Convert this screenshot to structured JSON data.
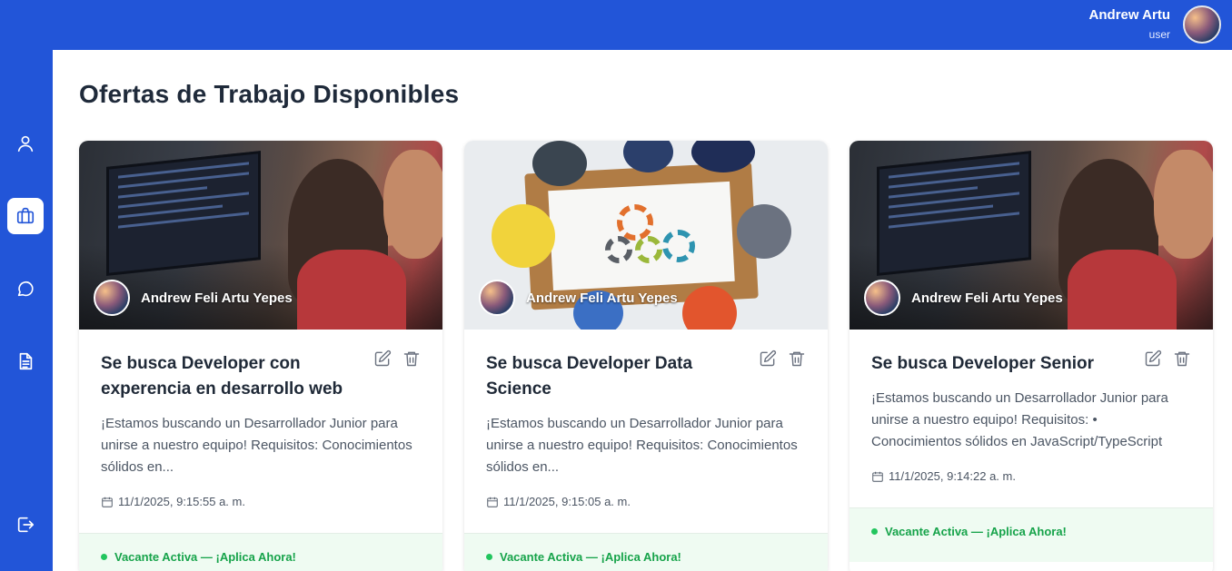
{
  "header": {
    "user_name": "Andrew Artu",
    "user_role": "user",
    "avatar_icon": "user-avatar"
  },
  "sidebar": {
    "items": [
      {
        "icon": "user-icon",
        "active": false
      },
      {
        "icon": "briefcase-icon",
        "active": true
      },
      {
        "icon": "chat-icon",
        "active": false
      },
      {
        "icon": "document-icon",
        "active": false
      }
    ],
    "logout_icon": "logout-icon"
  },
  "page": {
    "title": "Ofertas de Trabajo Disponibles"
  },
  "jobs": [
    {
      "author": "Andrew Feli Artu Yepes",
      "title": "Se busca Developer con experencia en desarrollo web",
      "description": "¡Estamos buscando un Desarrollador Junior para unirse a nuestro equipo! Requisitos: Conocimientos sólidos en...",
      "date": "11/1/2025, 9:15:55 a. m.",
      "status": "Vacante Activa — ¡Aplica Ahora!"
    },
    {
      "author": "Andrew Feli Artu Yepes",
      "title": "Se busca Developer Data Science",
      "description": "¡Estamos buscando un Desarrollador Junior para unirse a nuestro equipo! Requisitos: Conocimientos sólidos en...",
      "date": "11/1/2025, 9:15:05 a. m.",
      "status": "Vacante Activa — ¡Aplica Ahora!"
    },
    {
      "author": "Andrew Feli Artu Yepes",
      "title": "Se busca Developer Senior",
      "description": "¡Estamos buscando un Desarrollador Junior para unirse a nuestro equipo! Requisitos: • Conocimientos sólidos en JavaScript/TypeScript",
      "date": "11/1/2025, 9:14:22 a. m.",
      "status": "Vacante Activa — ¡Aplica Ahora!"
    }
  ],
  "colors": {
    "primary": "#2255d8",
    "status_green": "#16a34a",
    "footer_bg": "#effbf2"
  }
}
